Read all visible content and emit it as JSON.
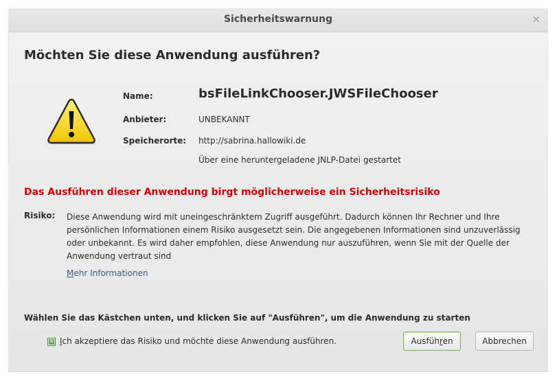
{
  "window": {
    "title": "Sicherheitswarnung",
    "close_glyph": "×"
  },
  "question": "Möchten Sie diese Anwendung ausführen?",
  "details": {
    "name_label": "Name:",
    "name_value": "bsFileLinkChooser.JWSFileChooser",
    "publisher_label": "Anbieter:",
    "publisher_value": "UNBEKANNT",
    "locations_label": "Speicherorte:",
    "location_url": "http://sabrina.hallowiki.de",
    "location_note": "Über eine heruntergeladene JNLP-Datei gestartet"
  },
  "warning_icon": "warning-triangle-icon",
  "risk": {
    "heading": "Das Ausführen dieser Anwendung birgt möglicherweise ein Sicherheitsrisiko",
    "label": "Risiko:",
    "text": "Diese Anwendung wird mit uneingeschränktem Zugriff ausgeführt. Dadurch können Ihr Rechner und Ihre persönlichen Informationen einem Risiko ausgesetzt sein. Die angegebenen Informationen sind unzuverlässig oder unbekannt. Es wird daher empfohlen, diese Anwendung nur auszuführen, wenn Sie mit der Quelle der Anwendung vertraut sind",
    "more_info_first": "M",
    "more_info_rest": "ehr Informationen"
  },
  "instruction": "Wählen Sie das Kästchen unten, und klicken Sie auf \"Ausführen\", um die Anwendung zu starten",
  "accept": {
    "checked": true,
    "label_first": "I",
    "label_rest": "ch akzeptiere das Risiko und möchte diese Anwendung ausführen."
  },
  "buttons": {
    "run_pre": "Ausfüh",
    "run_mn": "r",
    "run_post": "en",
    "cancel": "Abbrechen"
  },
  "colors": {
    "risk_heading": "#d40000",
    "link": "#3b5a8a",
    "checkbox_accent": "#6aa84f",
    "icon_yellow": "#f5d000"
  }
}
